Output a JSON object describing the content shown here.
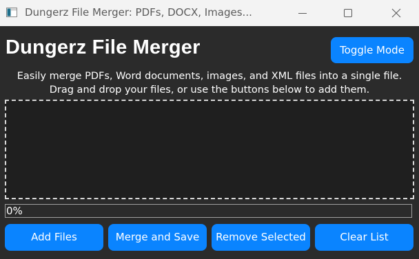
{
  "window": {
    "title": "Dungerz File Merger: PDFs, DOCX, Images...",
    "app_icon": "app-icon",
    "controls": [
      "minimize-icon",
      "maximize-icon",
      "close-icon"
    ]
  },
  "header": {
    "title": "Dungerz File Merger",
    "toggle_label": "Toggle Mode"
  },
  "description": "Easily merge PDFs, Word documents, images, and XML files into a single file. Drag and drop your files, or use the buttons below to add them.",
  "file_list": {
    "items": []
  },
  "progress": {
    "value": 0,
    "text": "0%"
  },
  "actions": {
    "add_files": "Add Files",
    "merge_save": "Merge and Save",
    "remove_selected": "Remove Selected",
    "clear_list": "Clear List"
  },
  "colors": {
    "accent": "#0a84ff",
    "background": "#2b2b2b",
    "dropzone": "#1f1f1f",
    "titlebar": "#f3f3f3"
  }
}
